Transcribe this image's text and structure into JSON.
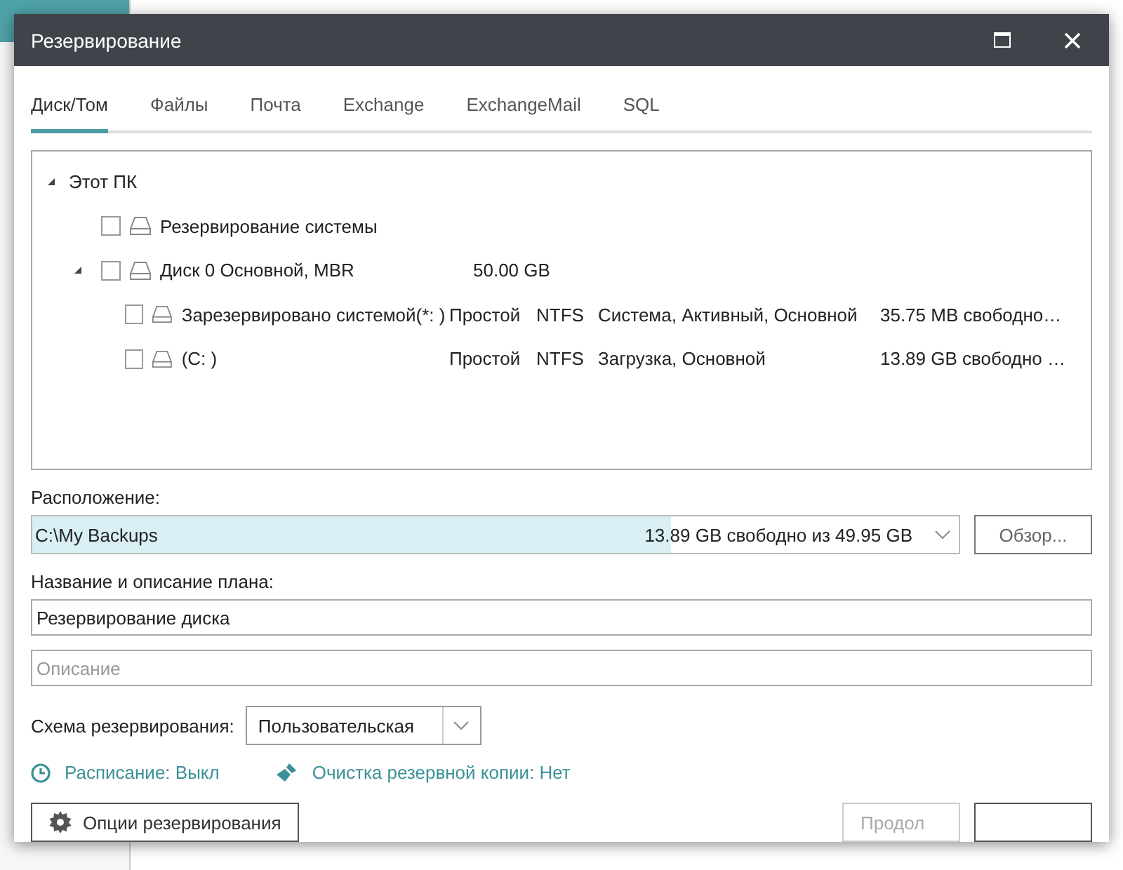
{
  "window": {
    "title": "Резервирование"
  },
  "tabs": [
    {
      "label": "Диск/Том",
      "selected": true
    },
    {
      "label": "Файлы",
      "selected": false
    },
    {
      "label": "Почта",
      "selected": false
    },
    {
      "label": "Exchange",
      "selected": false
    },
    {
      "label": "ExchangeMail",
      "selected": false
    },
    {
      "label": "SQL",
      "selected": false
    }
  ],
  "tree": [
    {
      "label": "Этот ПК",
      "kind": "group",
      "expanded": true,
      "children": [
        {
          "label": "Резервирование системы",
          "kind": "drive",
          "checked": false
        },
        {
          "label": "Диск 0 Основной, MBR",
          "kind": "drive",
          "checked": false,
          "expanded": true,
          "columns": [
            "50.00 GB"
          ],
          "children": [
            {
              "label": "Зарезервировано системой(*: )",
              "kind": "drive",
              "checked": false,
              "columns": [
                "Простой",
                "NTFS",
                "Система, Активный, Основной",
                "35.75 MB свободно…"
              ]
            },
            {
              "label": "(C: )",
              "kind": "drive",
              "checked": false,
              "columns": [
                "Простой",
                "NTFS",
                "Загрузка, Основной",
                "13.89 GB свободно …"
              ]
            }
          ]
        }
      ]
    }
  ],
  "location": {
    "label": "Расположение:",
    "value": "C:\\My Backups",
    "free": "13.89 GB свободно из 49.95 GB",
    "level": 0.69,
    "browse": "Обзор..."
  },
  "plan": {
    "label": "Название и описание плана:",
    "name": "Резервирование диска",
    "description_placeholder": "Описание"
  },
  "scheme": {
    "label": "Схема резервирования:",
    "value": "Пользовательская"
  },
  "links": [
    {
      "kind": "schedule",
      "text": "Расписание: Выкл"
    },
    {
      "kind": "cleanup",
      "text": "Очистка резервной копии: Нет"
    }
  ],
  "options_button": "Опции резервирования",
  "footer_buttons": [
    {
      "label": "Продол",
      "disabled": true
    },
    {
      "disabled": false
    }
  ]
}
